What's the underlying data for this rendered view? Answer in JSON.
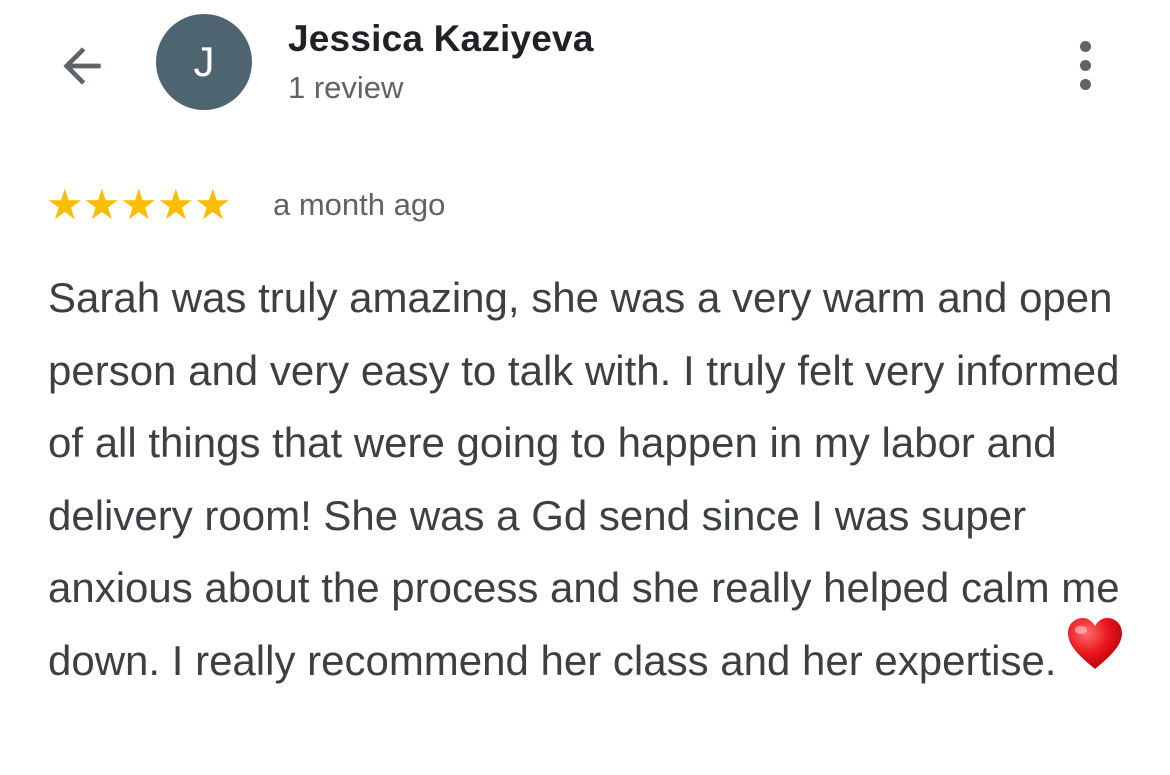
{
  "header": {
    "back_icon": "arrow-left-icon",
    "avatar_initial": "J",
    "avatar_color": "#4f6471",
    "reviewer_name": "Jessica Kaziyeva",
    "review_count": "1 review",
    "more_icon": "more-vertical-icon"
  },
  "review": {
    "rating": 5,
    "rating_max": 5,
    "star_color": "#fbbc04",
    "date": "a month ago",
    "text": "Sarah was truly amazing, she was a very warm and open person and very easy to talk with. I truly felt very informed of all things that were going to happen in my labor and delivery room! She was a Gd send since I was super anxious about the process and she really helped calm me down. I really recommend her class and her expertise.",
    "emoji_icon": "red-heart-icon"
  }
}
